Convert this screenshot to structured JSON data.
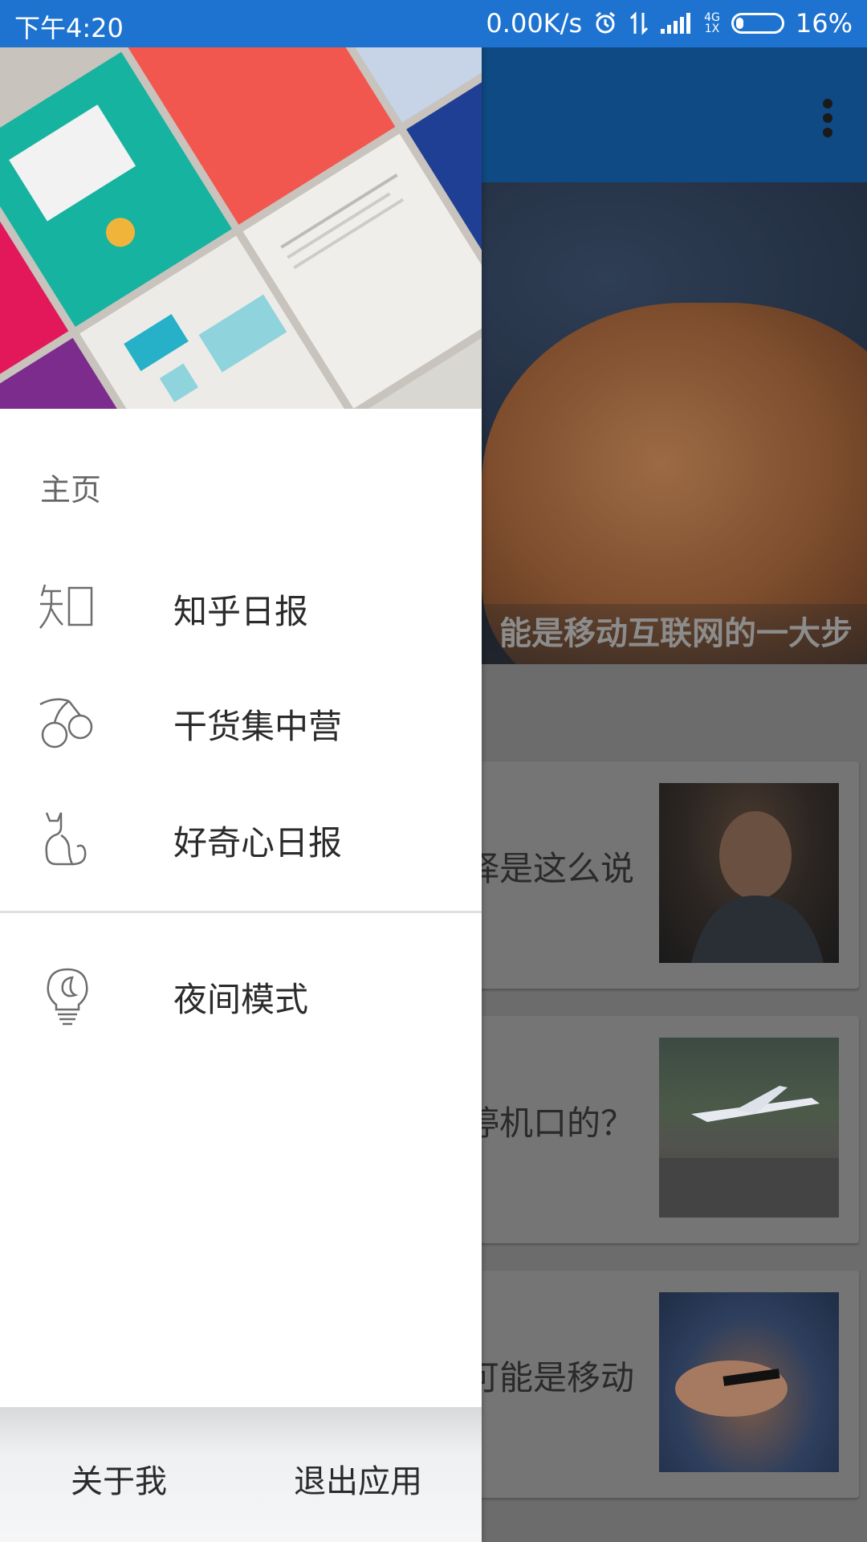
{
  "status_bar": {
    "time": "下午4:20",
    "net_speed": "0.00K/s",
    "net_type_top": "4G",
    "net_type_bottom": "1X",
    "battery_percent": "16%",
    "battery_level": 0.16,
    "icons": [
      "alarm-icon",
      "data-arrows-icon",
      "signal-icon",
      "battery-icon"
    ]
  },
  "background": {
    "toolbar": {
      "overflow_icon": "more-vert-icon"
    },
    "hero_title": "能是移动互联网的一大步",
    "cards": [
      {
        "title": "择是这么说"
      },
      {
        "title": "停机口的？"
      },
      {
        "title": "可能是移动"
      }
    ]
  },
  "drawer": {
    "section_label": "主页",
    "items": [
      {
        "label": "知乎日报",
        "icon": "zhihu-icon"
      },
      {
        "label": "干货集中营",
        "icon": "cherry-icon"
      },
      {
        "label": "好奇心日报",
        "icon": "cat-icon"
      }
    ],
    "secondary_items": [
      {
        "label": "夜间模式",
        "icon": "lightbulb-icon"
      }
    ],
    "footer": {
      "about_label": "关于我",
      "exit_label": "退出应用"
    }
  },
  "colors": {
    "status_bar": "#1e73d0",
    "toolbar": "#0f4a84",
    "drawer_bg": "#ffffff"
  }
}
